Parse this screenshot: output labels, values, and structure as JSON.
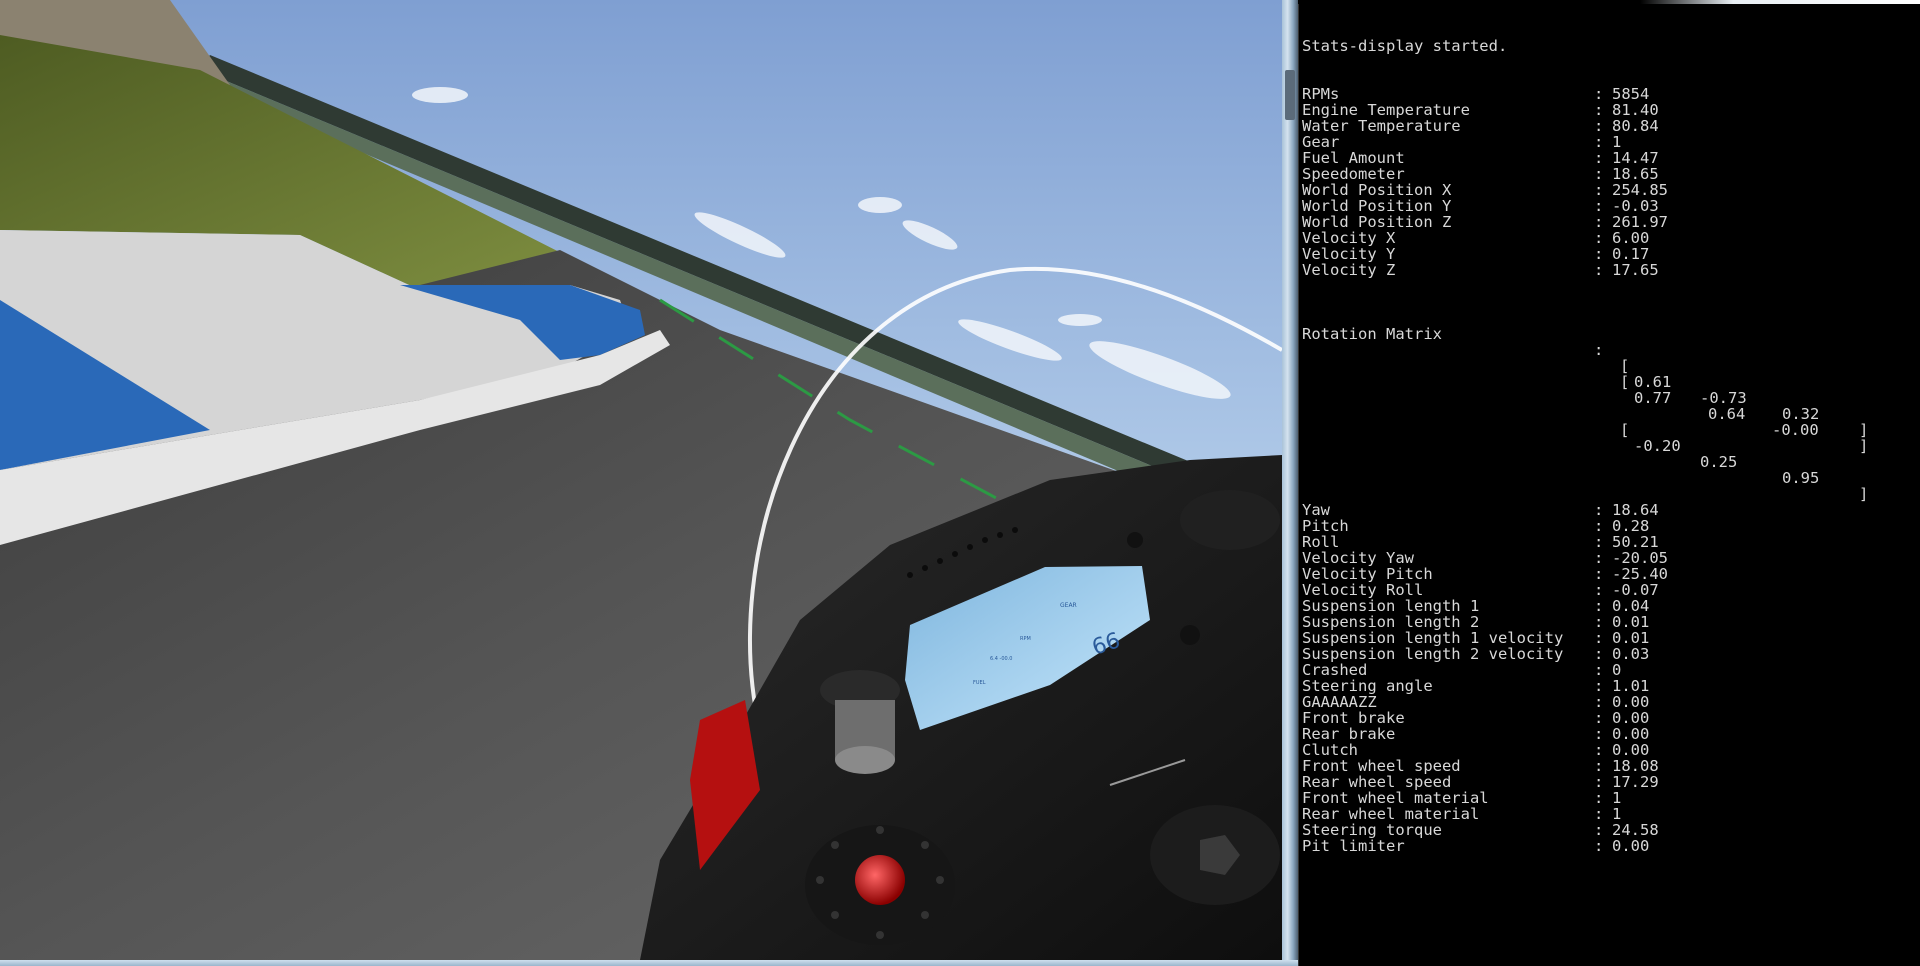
{
  "console": {
    "header": "Stats-display started.",
    "separator": ":",
    "stats_top": [
      {
        "label": "RPMs",
        "value": "5854"
      },
      {
        "label": "Engine Temperature",
        "value": "81.40"
      },
      {
        "label": "Water Temperature",
        "value": "80.84"
      },
      {
        "label": "Gear",
        "value": "1"
      },
      {
        "label": "Fuel Amount",
        "value": "14.47"
      },
      {
        "label": "Speedometer",
        "value": "18.65"
      },
      {
        "label": "World Position X",
        "value": "254.85"
      },
      {
        "label": "World Position Y",
        "value": "-0.03"
      },
      {
        "label": "World Position Z",
        "value": "261.97"
      },
      {
        "label": "Velocity X",
        "value": "6.00"
      },
      {
        "label": "Velocity Y",
        "value": "0.17"
      },
      {
        "label": "Velocity Z",
        "value": "17.65"
      }
    ],
    "rotation_label": "Rotation Matrix",
    "rotation_matrix": [
      [
        "[",
        "0.61",
        "-0.73",
        "0.32",
        "]"
      ],
      [
        "[",
        "0.77",
        "0.64",
        "-0.00",
        "]"
      ],
      [
        "[",
        "-0.20",
        "0.25",
        "0.95",
        "]"
      ]
    ],
    "stats_bottom": [
      {
        "label": "Yaw",
        "value": "18.64"
      },
      {
        "label": "Pitch",
        "value": "0.28"
      },
      {
        "label": "Roll",
        "value": "50.21"
      },
      {
        "label": "Velocity Yaw",
        "value": "-20.05"
      },
      {
        "label": "Velocity Pitch",
        "value": "-25.40"
      },
      {
        "label": "Velocity Roll",
        "value": "-0.07"
      },
      {
        "label": "Suspension length 1",
        "value": "0.04"
      },
      {
        "label": "Suspension length 2",
        "value": "0.01"
      },
      {
        "label": "Suspension length 1 velocity",
        "value": "0.01"
      },
      {
        "label": "Suspension length 2 velocity",
        "value": "0.03"
      },
      {
        "label": "Crashed",
        "value": "0"
      },
      {
        "label": "Steering angle",
        "value": "1.01"
      },
      {
        "label": "GAAAAAZZ",
        "value": "0.00"
      },
      {
        "label": "Front brake",
        "value": "0.00"
      },
      {
        "label": "Rear brake",
        "value": "0.00"
      },
      {
        "label": "Clutch",
        "value": "0.00"
      },
      {
        "label": "Front wheel speed",
        "value": "18.08"
      },
      {
        "label": "Rear wheel speed",
        "value": "17.29"
      },
      {
        "label": "Front wheel material",
        "value": "1"
      },
      {
        "label": "Rear wheel material",
        "value": "1"
      },
      {
        "label": "Steering torque",
        "value": "24.58"
      },
      {
        "label": "Pit limiter",
        "value": "0.00"
      }
    ]
  },
  "dashboard": {
    "gear_label": "GEAR",
    "speed": "66",
    "rpm_label": "RPM",
    "fuel_label": "FUEL",
    "odo_label": "6.4 -00.0"
  },
  "colors": {
    "sky_top": "#86a6d6",
    "sky_bottom": "#d7e8f4",
    "grass": "#6a7a34",
    "asphalt": "#4a4a4a",
    "curb_blue": "#2a69b8",
    "curb_white": "#d9d9d9",
    "dash_lcd": "#a9d6f2",
    "console_text": "#d8d8d8"
  }
}
